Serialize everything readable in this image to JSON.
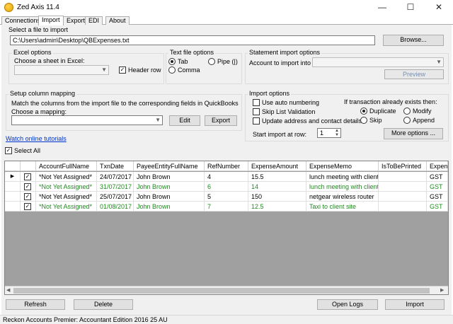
{
  "window": {
    "title": "Zed Axis 11.4",
    "controls": {
      "minimize": "—",
      "maximize": "☐",
      "close": "✕"
    }
  },
  "tabs": [
    "Connections",
    "Import",
    "Export",
    "EDI",
    "About"
  ],
  "active_tab": "Import",
  "file_section": {
    "label": "Select a file to import",
    "path": "C:\\Users\\admin\\Desktop\\QBExpenses.txt",
    "browse_label": "Browse..."
  },
  "excel_options": {
    "title": "Excel options",
    "sheet_label": "Choose a sheet in Excel:",
    "sheet_value": "",
    "header_row_label": "Header row",
    "header_row_checked": true
  },
  "text_file_options": {
    "title": "Text file options",
    "tab_label": "Tab",
    "pipe_label": "Pipe (|)",
    "comma_label": "Comma",
    "selected": "Tab"
  },
  "statement_options": {
    "title": "Statement import options",
    "account_label": "Account to import into",
    "account_value": "",
    "preview_label": "Preview"
  },
  "column_mapping": {
    "title": "Setup column mapping",
    "description": "Match the columns from the import file to the corresponding fields in QuickBooks",
    "mapping_label": "Choose a mapping:",
    "mapping_value": "",
    "edit_label": "Edit",
    "export_label": "Export"
  },
  "import_options": {
    "title": "Import options",
    "use_auto_numbering": "Use auto numbering",
    "skip_list_validation": "Skip List Validation",
    "update_address": "Update address and contact details",
    "if_exists_label": "If transaction already exists then:",
    "duplicate_label": "Duplicate",
    "modify_label": "Modify",
    "skip_label": "Skip",
    "append_label": "Append",
    "exists_selected": "Duplicate",
    "start_row_label": "Start import at row:",
    "start_row_value": "1",
    "more_options_label": "More options ..."
  },
  "watch_tutorials_label": "Watch online tutorials",
  "select_all_label": "Select All",
  "select_all_checked": true,
  "grid": {
    "columns": [
      "AccountFullName",
      "TxnDate",
      "PayeeEntityFullName",
      "RefNumber",
      "ExpenseAmount",
      "ExpenseMemo",
      "IsToBePrinted",
      "Expens"
    ],
    "rows": [
      {
        "checked": true,
        "green": false,
        "current": true,
        "cells": [
          "*Not Yet Assigned*",
          "24/07/2017",
          "John Brown",
          "4",
          "15.5",
          "lunch meeting with client",
          "",
          "GST"
        ]
      },
      {
        "checked": true,
        "green": true,
        "current": false,
        "cells": [
          "*Not Yet Assigned*",
          "31/07/2017",
          "John Brown",
          "6",
          "14",
          "lunch meeting with client",
          "",
          "GST"
        ]
      },
      {
        "checked": true,
        "green": false,
        "current": false,
        "cells": [
          "*Not Yet Assigned*",
          "25/07/2017",
          "John Brown",
          "5",
          "150",
          "netgear wireless router",
          "",
          "GST"
        ]
      },
      {
        "checked": true,
        "green": true,
        "current": false,
        "cells": [
          "*Not Yet Assigned*",
          "01/08/2017",
          "John Brown",
          "7",
          "12.5",
          "Taxi to client site",
          "",
          "GST"
        ]
      }
    ]
  },
  "bottom_buttons": {
    "refresh": "Refresh",
    "delete": "Delete",
    "open_logs": "Open Logs",
    "import": "Import"
  },
  "status_bar": "Reckon Accounts Premier: Accountant Edition 2016  25  AU"
}
